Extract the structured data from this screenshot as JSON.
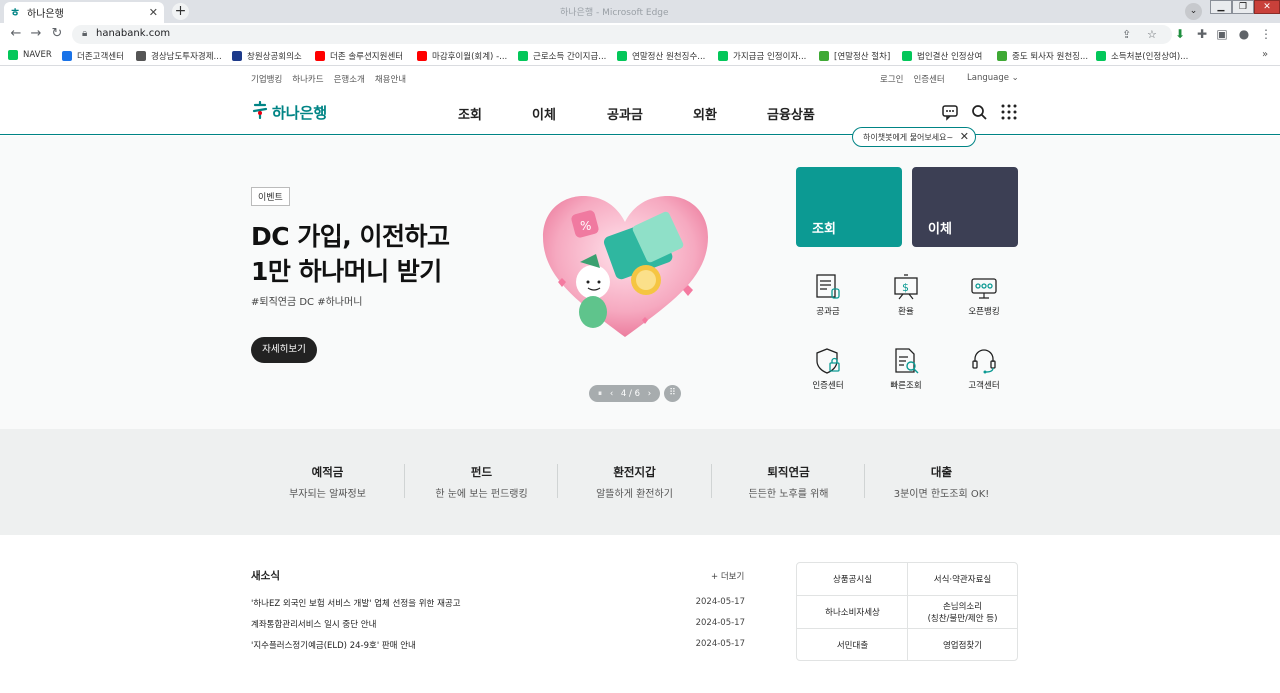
{
  "browser": {
    "tab_title": "하나은행",
    "window_title": "하나은행 - Microsoft Edge",
    "url": "hanabank.com",
    "bookmarks": [
      {
        "label": "NAVER",
        "color": "#03c75a"
      },
      {
        "label": "더존고객센터",
        "color": "#1a73e8"
      },
      {
        "label": "경상남도투자경제...",
        "color": "#555555"
      },
      {
        "label": "창원상공회의소",
        "color": "#1d3a8a"
      },
      {
        "label": "더존 솔루션지원센터",
        "color": "#ff0000"
      },
      {
        "label": "마감후이월(회계) -...",
        "color": "#ff0000"
      },
      {
        "label": "근로소득 간이지급...",
        "color": "#03c75a"
      },
      {
        "label": "연말정산 원천징수...",
        "color": "#03c75a"
      },
      {
        "label": "가지급금 인정이자...",
        "color": "#03c75a"
      },
      {
        "label": "[연말정산 절차]",
        "color": "#3fa935"
      },
      {
        "label": "법인결산 인정상여",
        "color": "#03c75a"
      },
      {
        "label": "중도 퇴사자 원천징...",
        "color": "#3fa935"
      },
      {
        "label": "소득처분(인정상여)...",
        "color": "#03c75a"
      }
    ]
  },
  "util": {
    "left": [
      "기업뱅킹",
      "하나카드",
      "은행소개",
      "채용안내"
    ],
    "right": [
      "로그인",
      "인증센터"
    ],
    "language": "Language"
  },
  "header": {
    "logo": "하나은행",
    "menu": [
      "조회",
      "이체",
      "공과금",
      "외환",
      "금융상품"
    ],
    "chat_popup": "하이챗봇에게 물어보세요~"
  },
  "hero": {
    "badge": "이벤트",
    "title_line1": "DC 가입, 이전하고",
    "title_line2": "1만 하나머니 받기",
    "tags": "#퇴직연금 DC #하나머니",
    "button": "자세히보기",
    "slide_indicator": "4 / 6",
    "current_slide": 4,
    "total_slides": 6
  },
  "quick": {
    "big": [
      {
        "label": "조회",
        "color": "#0c9a93"
      },
      {
        "label": "이체",
        "color": "#3c3f54"
      }
    ],
    "icons": [
      {
        "label": "공과금",
        "icon": "bill-icon"
      },
      {
        "label": "환율",
        "icon": "exchange-rate-icon"
      },
      {
        "label": "오픈뱅킹",
        "icon": "open-banking-icon"
      },
      {
        "label": "인증센터",
        "icon": "certificate-icon"
      },
      {
        "label": "빠른조회",
        "icon": "quick-inquiry-icon"
      },
      {
        "label": "고객센터",
        "icon": "customer-center-icon"
      }
    ]
  },
  "categories": [
    {
      "title": "예적금",
      "sub": "부자되는 알짜정보"
    },
    {
      "title": "펀드",
      "sub": "한 눈에 보는 펀드랭킹"
    },
    {
      "title": "환전지갑",
      "sub": "알뜰하게 환전하기"
    },
    {
      "title": "퇴직연금",
      "sub": "든든한 노후를 위해"
    },
    {
      "title": "대출",
      "sub": "3분이면 한도조회 OK!"
    }
  ],
  "news": {
    "title": "새소식",
    "more": "+ 더보기",
    "items": [
      {
        "text": "'하나EZ 외국인 보험 서비스 개발' 업체 선정을 위한 재공고",
        "date": "2024-05-17"
      },
      {
        "text": "계좌통합관리서비스 일시 중단 안내",
        "date": "2024-05-17"
      },
      {
        "text": "'지수플러스정기예금(ELD) 24-9호' 판매 안내",
        "date": "2024-05-17"
      }
    ]
  },
  "links": {
    "l1": "상품공시실",
    "l2": "서식·약관자료실",
    "l3": "하나소비자세상",
    "l4a": "손님의소리",
    "l4b": "(칭찬/불만/제안 등)",
    "l5": "서민대출",
    "l6": "영업점찾기"
  }
}
